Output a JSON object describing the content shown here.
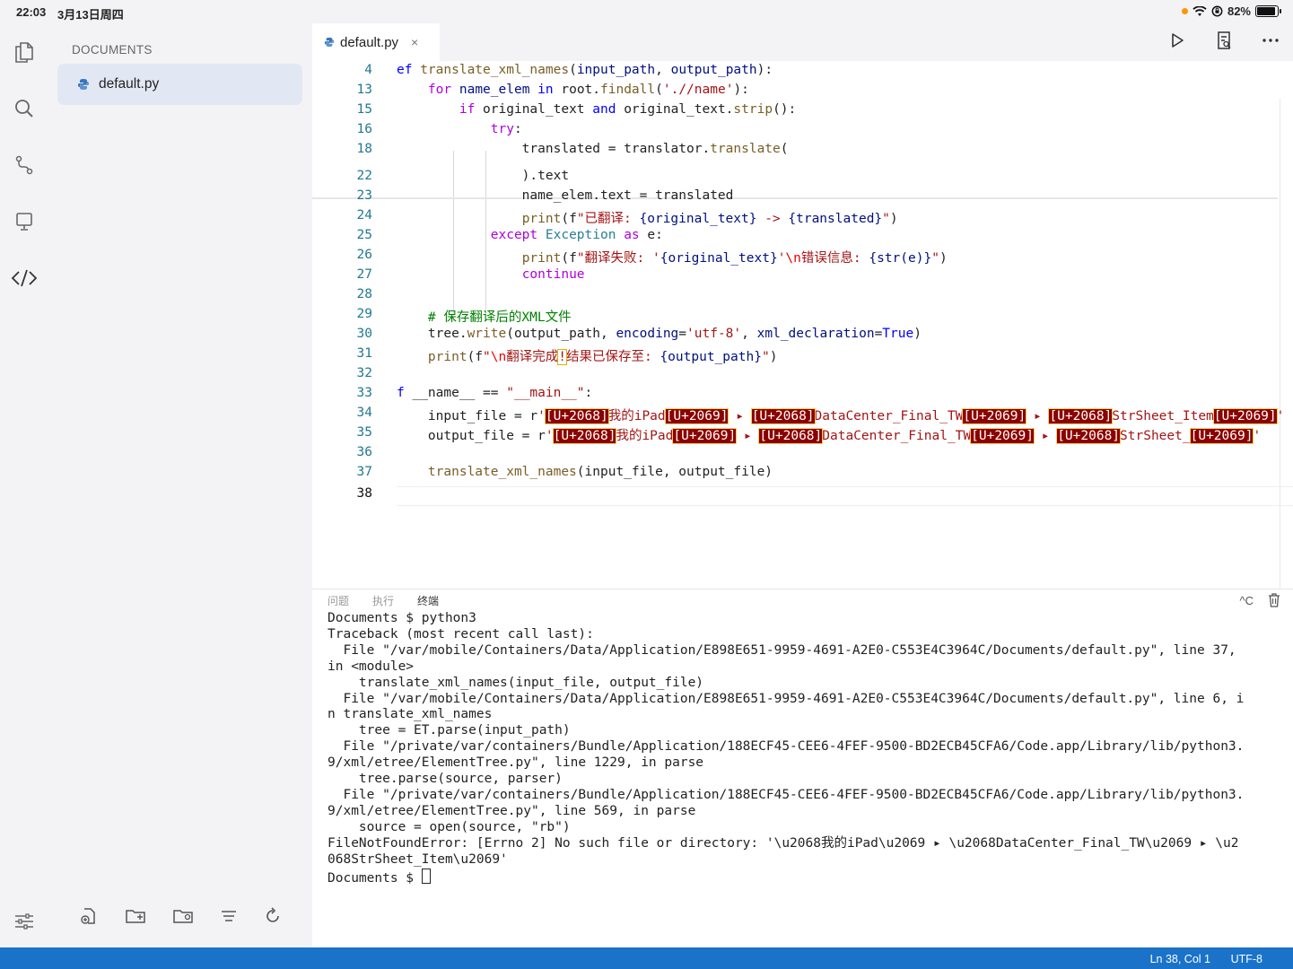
{
  "status": {
    "time": "22:03",
    "date": "3月13日周四",
    "battery": "82%"
  },
  "sidebar": {
    "title": "DOCUMENTS",
    "file": "default.py"
  },
  "tab": {
    "name": "default.py",
    "close": "×"
  },
  "gutter": [
    "4",
    "13",
    "15",
    "16",
    "18",
    "22",
    "23",
    "24",
    "25",
    "26",
    "27",
    "28",
    "29",
    "30",
    "31",
    "32",
    "33",
    "34",
    "35",
    "36",
    "37",
    "38"
  ],
  "code": {
    "l4a": "ef ",
    "l4b": "translate_xml_names",
    "l4c": "(",
    "l4d": "input_path",
    "l4e": ", ",
    "l4f": "output_path",
    "l4g": "):",
    "l13a": "    ",
    "l13b": "for",
    "l13c": " name_elem ",
    "l13d": "in",
    "l13e": " root.",
    "l13f": "findall",
    "l13g": "(",
    "l13h": "'.//name'",
    "l13i": "):",
    "l15a": "        ",
    "l15b": "if",
    "l15c": " original_text ",
    "l15d": "and",
    "l15e": " original_text.",
    "l15f": "strip",
    "l15g": "():",
    "l16a": "            ",
    "l16b": "try",
    "l16c": ":",
    "l18a": "                translated = translator.",
    "l18b": "translate",
    "l18c": "(",
    "l22": "                ).text",
    "l23": "                name_elem.text = translated",
    "l24a": "                ",
    "l24b": "print",
    "l24c": "(f",
    "l24d": "\"已翻译: ",
    "l24e": "{original_text}",
    "l24f": " -> ",
    "l24g": "{translated}",
    "l24h": "\"",
    "l24i": ")",
    "l25a": "            ",
    "l25b": "except",
    "l25c": " ",
    "l25d": "Exception",
    "l25e": " ",
    "l25f": "as",
    "l25g": " e:",
    "l26a": "                ",
    "l26b": "print",
    "l26c": "(f",
    "l26d": "\"翻译失败: '",
    "l26e": "{original_text}",
    "l26f": "'",
    "l26g": "\\n",
    "l26h": "错误信息: ",
    "l26i": "{str(e)}",
    "l26j": "\"",
    "l26k": ")",
    "l27a": "                ",
    "l27b": "continue",
    "l29": "    # 保存翻译后的XML文件",
    "l30a": "    tree.",
    "l30b": "write",
    "l30c": "(output_path, ",
    "l30d": "encoding",
    "l30e": "=",
    "l30f": "'utf-8'",
    "l30g": ", ",
    "l30h": "xml_declaration",
    "l30i": "=",
    "l30j": "True",
    "l30k": ")",
    "l31a": "    ",
    "l31b": "print",
    "l31c": "(f",
    "l31d": "\"",
    "l31e": "\\n",
    "l31f": "翻译完成",
    "l31g": "!",
    "l31h": "结果已保存至: ",
    "l31i": "{output_path}",
    "l31j": "\"",
    "l31k": ")",
    "l33a": "f",
    "l33b": " __name__ == ",
    "l33c": "\"__main__\"",
    "l33d": ":",
    "l34a": "    input_file = r",
    "l34b": "'",
    "l34c": "[U+2068]",
    "l34d": "我的iPad",
    "l34e": "[U+2069]",
    "l34f": " ▸ ",
    "l34g": "[U+2068]",
    "l34h": "DataCenter_Final_TW",
    "l34i": "[U+2069]",
    "l34j": " ▸ ",
    "l34k": "[U+2068]",
    "l34l": "StrSheet_Item",
    "l34m": "[U+2069]",
    "l34n": "'",
    "l35a": "    output_file = r",
    "l35b": "'",
    "l35c": "[U+2068]",
    "l35d": "我的iPad",
    "l35e": "[U+2069]",
    "l35f": " ▸ ",
    "l35g": "[U+2068]",
    "l35h": "DataCenter_Final_TW",
    "l35i": "[U+2069]",
    "l35j": " ▸ ",
    "l35k": "[U+2068]",
    "l35l": "StrSheet_",
    "l35m": "[U+2069]",
    "l35n": "'",
    "l37a": "    ",
    "l37b": "translate_xml_names",
    "l37c": "(input_file, output_file)"
  },
  "panel": {
    "tabs": [
      "问题",
      "执行",
      "终端"
    ],
    "ctrl": "^C",
    "terminal": "Documents $ python3\nTraceback (most recent call last):\n  File \"/var/mobile/Containers/Data/Application/E898E651-9959-4691-A2E0-C553E4C3964C/Documents/default.py\", line 37,\nin <module>\n    translate_xml_names(input_file, output_file)\n  File \"/var/mobile/Containers/Data/Application/E898E651-9959-4691-A2E0-C553E4C3964C/Documents/default.py\", line 6, i\nn translate_xml_names\n    tree = ET.parse(input_path)\n  File \"/private/var/containers/Bundle/Application/188ECF45-CEE6-4FEF-9500-BD2ECB45CFA6/Code.app/Library/lib/python3.\n9/xml/etree/ElementTree.py\", line 1229, in parse\n    tree.parse(source, parser)\n  File \"/private/var/containers/Bundle/Application/188ECF45-CEE6-4FEF-9500-BD2ECB45CFA6/Code.app/Library/lib/python3.\n9/xml/etree/ElementTree.py\", line 569, in parse\n    source = open(source, \"rb\")\nFileNotFoundError: [Errno 2] No such file or directory: '\\u2068我的iPad\\u2069 ▸ \\u2068DataCenter_Final_TW\\u2069 ▸ \\u2\n068StrSheet_Item\\u2069'\n",
    "prompt": "Documents $ "
  },
  "bottombar": {
    "position": "Ln 38, Col 1",
    "encoding": "UTF-8"
  },
  "colors": {
    "accent": "#1a73c9",
    "keyword": "#0000ff",
    "string": "#a31515",
    "comment": "#008000",
    "invalid_char_bg": "#8b0000"
  }
}
